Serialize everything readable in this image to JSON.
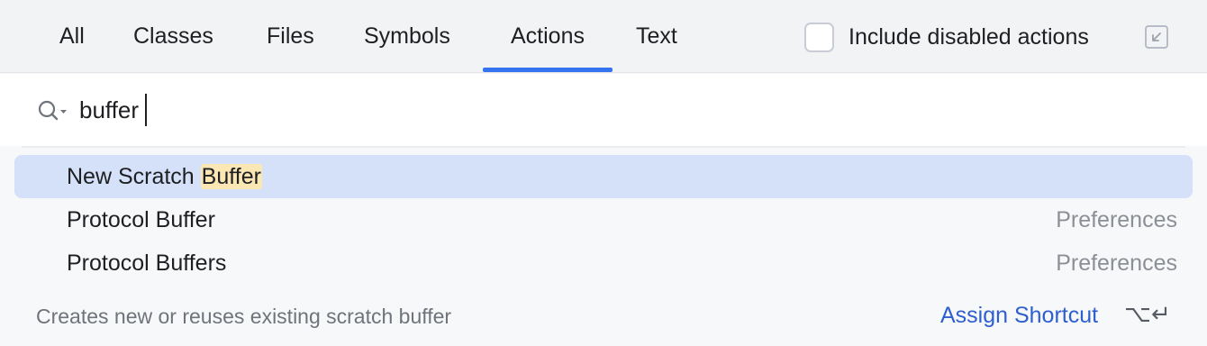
{
  "tabs": [
    {
      "label": "All"
    },
    {
      "label": "Classes"
    },
    {
      "label": "Files"
    },
    {
      "label": "Symbols"
    },
    {
      "label": "Actions",
      "active": true
    },
    {
      "label": "Text"
    }
  ],
  "include_disabled": {
    "label": "Include disabled actions",
    "checked": false
  },
  "search": {
    "value": "buffer",
    "placeholder": ""
  },
  "results": [
    {
      "prefix": "New Scratch ",
      "match": "Buffer",
      "location": "",
      "selected": true
    },
    {
      "label": "Protocol Buffer",
      "location": "Preferences"
    },
    {
      "label": "Protocol Buffers",
      "location": "Preferences"
    }
  ],
  "footer": {
    "description": "Creates new or reuses existing scratch buffer",
    "assign_shortcut": "Assign Shortcut",
    "shortcut_keys": "⌥↵"
  },
  "colors": {
    "accent": "#3574f0",
    "selection": "#d5e1f9",
    "highlight": "#fbe7b3",
    "link": "#2e5fcf"
  },
  "icons": [
    "search-icon",
    "open-in-window-icon"
  ]
}
